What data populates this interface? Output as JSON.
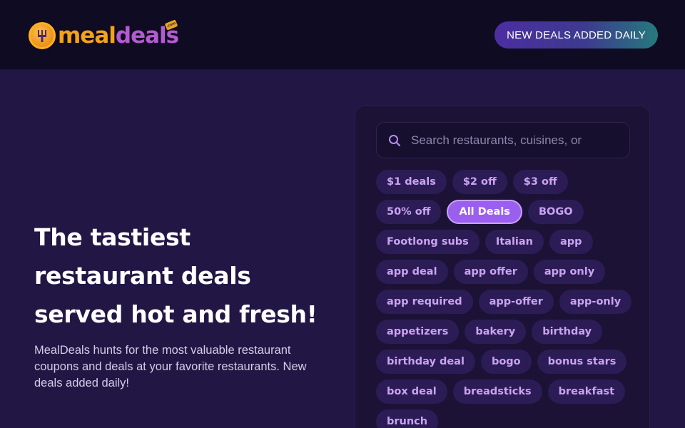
{
  "header": {
    "logo_text_meal": "meal",
    "logo_text_deals": "deals",
    "logo_tag": ".com",
    "badge": "NEW DEALS ADDED DAILY"
  },
  "hero": {
    "title": "The tastiest restaurant deals served hot and fresh!",
    "description": "MealDeals hunts for the most valuable restaurant coupons and deals at your favorite restaurants. New deals added daily!"
  },
  "search": {
    "placeholder": "Search restaurants, cuisines, or",
    "value": ""
  },
  "tags": [
    {
      "label": "$1 deals",
      "active": false
    },
    {
      "label": "$2 off",
      "active": false
    },
    {
      "label": "$3 off",
      "active": false
    },
    {
      "label": "50% off",
      "active": false
    },
    {
      "label": "All Deals",
      "active": true
    },
    {
      "label": "BOGO",
      "active": false
    },
    {
      "label": "Footlong subs",
      "active": false
    },
    {
      "label": "Italian",
      "active": false
    },
    {
      "label": "app",
      "active": false
    },
    {
      "label": "app deal",
      "active": false
    },
    {
      "label": "app offer",
      "active": false
    },
    {
      "label": "app only",
      "active": false
    },
    {
      "label": "app required",
      "active": false
    },
    {
      "label": "app-offer",
      "active": false
    },
    {
      "label": "app-only",
      "active": false
    },
    {
      "label": "appetizers",
      "active": false
    },
    {
      "label": "bakery",
      "active": false
    },
    {
      "label": "birthday",
      "active": false
    },
    {
      "label": "birthday deal",
      "active": false
    },
    {
      "label": "bogo",
      "active": false
    },
    {
      "label": "bonus stars",
      "active": false
    },
    {
      "label": "box deal",
      "active": false
    },
    {
      "label": "breadsticks",
      "active": false
    },
    {
      "label": "breakfast",
      "active": false
    },
    {
      "label": "brunch",
      "active": false
    }
  ],
  "colors": {
    "background": "#221645",
    "header": "#0f0b22",
    "panel": "#1b1236",
    "tag": "#2c1c55",
    "tag_text": "#c9a3f2",
    "tag_active": "#9b5ff0",
    "brand_orange": "#f4a21a",
    "brand_purple": "#b35bd0"
  },
  "icons": {
    "logo": "fork-coin-logo-icon",
    "search": "search-icon"
  }
}
